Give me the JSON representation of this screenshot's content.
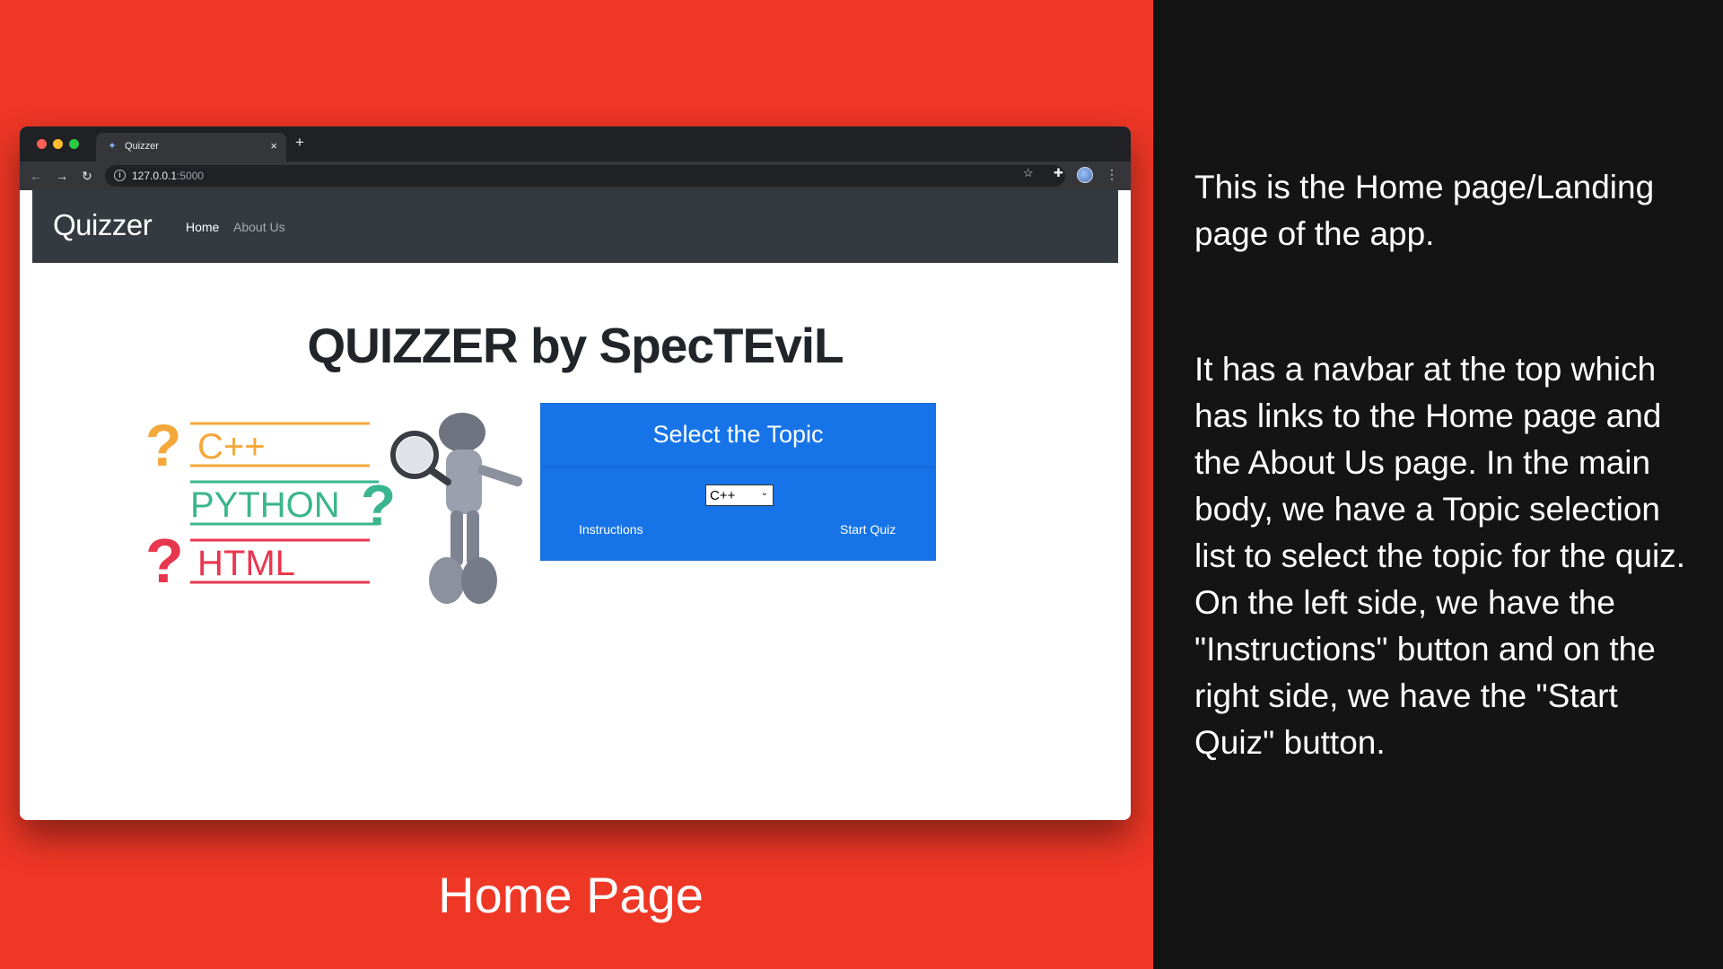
{
  "browser": {
    "tab_title": "Quizzer",
    "url_host": "127.0.0.1",
    "url_port": ":5000"
  },
  "site": {
    "brand": "Quizzer",
    "nav": {
      "home": "Home",
      "about": "About Us"
    },
    "heading": "QUIZZER by SpecTEviL",
    "hero_labels": {
      "cpp": "C++",
      "python": "PYTHON",
      "html": "HTML"
    },
    "card": {
      "title": "Select the Topic",
      "selected_topic": "C++",
      "instructions_label": "Instructions",
      "start_label": "Start Quiz"
    }
  },
  "caption": "Home Page",
  "description": {
    "paragraph1": "This is the Home page/Landing page of the app.",
    "paragraph2": "It has a navbar at the top which has links to the Home page and the About Us page. In the main body, we have a Topic selection list to select the topic for the quiz. On the left side, we have the \"Instructions\" button and on the right side, we have the \"Start Quiz\" button."
  },
  "colors": {
    "left_background": "#ef3726",
    "right_background": "#141414",
    "navbar": "#343a40",
    "card": "#1774e8",
    "cpp": "#f4a83a",
    "python": "#3bb58e",
    "html": "#e8364f"
  },
  "icons": [
    "back-icon",
    "forward-icon",
    "reload-icon",
    "info-icon",
    "star-icon",
    "extensions-icon",
    "profile-icon",
    "menu-icon",
    "close-icon",
    "plus-icon"
  ]
}
